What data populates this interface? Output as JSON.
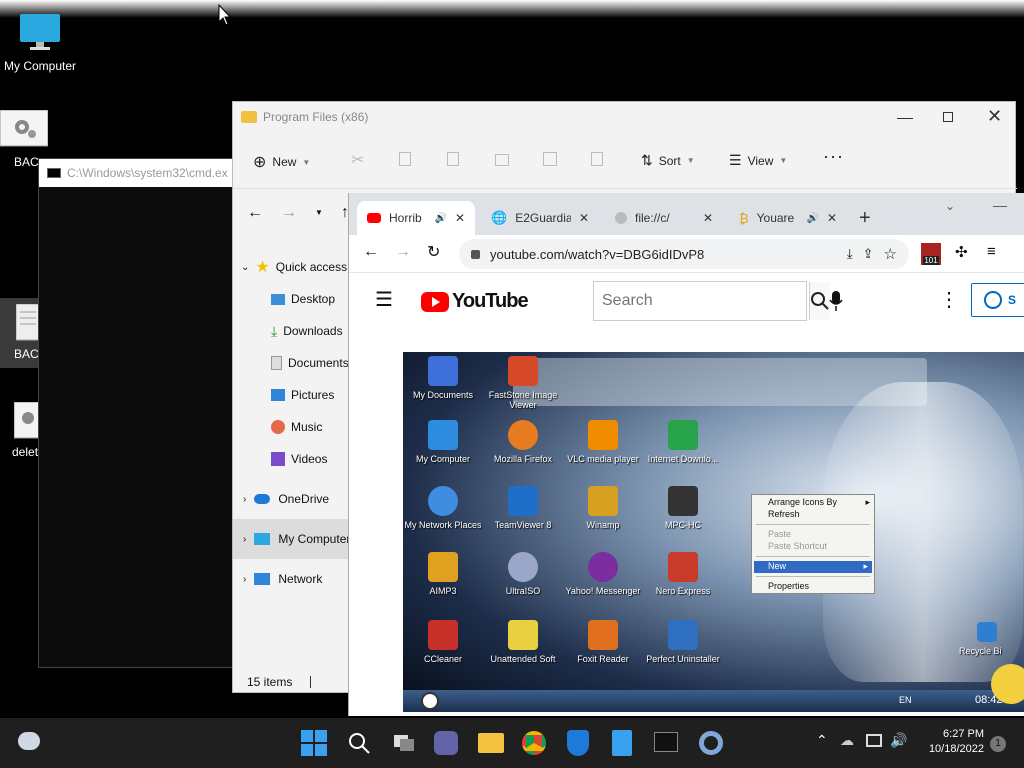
{
  "desktop": {
    "icons": [
      {
        "label": "My Computer"
      },
      {
        "label": "BAC"
      },
      {
        "label": "BAC"
      },
      {
        "label": "delet"
      }
    ]
  },
  "cmd": {
    "title": "C:\\Windows\\system32\\cmd.ex"
  },
  "explorer": {
    "title": "Program Files (x86)",
    "toolbar": {
      "new_label": "New",
      "sort_label": "Sort",
      "view_label": "View"
    },
    "nav": [
      {
        "label": "Quick access"
      },
      {
        "label": "Desktop"
      },
      {
        "label": "Downloads"
      },
      {
        "label": "Documents"
      },
      {
        "label": "Pictures"
      },
      {
        "label": "Music"
      },
      {
        "label": "Videos"
      },
      {
        "label": "OneDrive"
      },
      {
        "label": "My Computer"
      },
      {
        "label": "Network"
      }
    ],
    "status": "15 items"
  },
  "browser": {
    "tabs": [
      {
        "label": "Horrib"
      },
      {
        "label": "E2Guardia"
      },
      {
        "label": "file://c/"
      },
      {
        "label": "Youare"
      }
    ],
    "url": "youtube.com/watch?v=DBG6idIDvP8",
    "extension_badge": "101",
    "youtube": {
      "logo_text": "YouTube",
      "search_placeholder": "Search",
      "signin_partial": "S"
    }
  },
  "video": {
    "icons": [
      {
        "label": "My Documents"
      },
      {
        "label": "FastStone Image Viewer"
      },
      {
        "label": "My Computer"
      },
      {
        "label": "Mozilla Firefox"
      },
      {
        "label": "VLC media player"
      },
      {
        "label": "Internet Downlo..."
      },
      {
        "label": "My Network Places"
      },
      {
        "label": "TeamViewer 8"
      },
      {
        "label": "Winamp"
      },
      {
        "label": "MPC-HC"
      },
      {
        "label": "AIMP3"
      },
      {
        "label": "UltraISO"
      },
      {
        "label": "Yahoo! Messenger"
      },
      {
        "label": "Nero Express"
      },
      {
        "label": "CCleaner"
      },
      {
        "label": "Unattended Soft"
      },
      {
        "label": "Foxit Reader"
      },
      {
        "label": "Perfect Uninstaller"
      },
      {
        "label": "Recycle Bi"
      }
    ],
    "context_menu": {
      "arrange": "Arrange Icons By",
      "refresh": "Refresh",
      "paste": "Paste",
      "paste_shortcut": "Paste Shortcut",
      "new": "New",
      "properties": "Properties"
    },
    "tray_lang": "EN",
    "tray_time": "08:42"
  },
  "taskbar": {
    "time": "6:27 PM",
    "date": "10/18/2022",
    "notif_count": "1"
  },
  "colors": {
    "youtube_red": "#ff0000",
    "accent_blue": "#0067c0",
    "explorer_bg": "#f3f3f3"
  }
}
